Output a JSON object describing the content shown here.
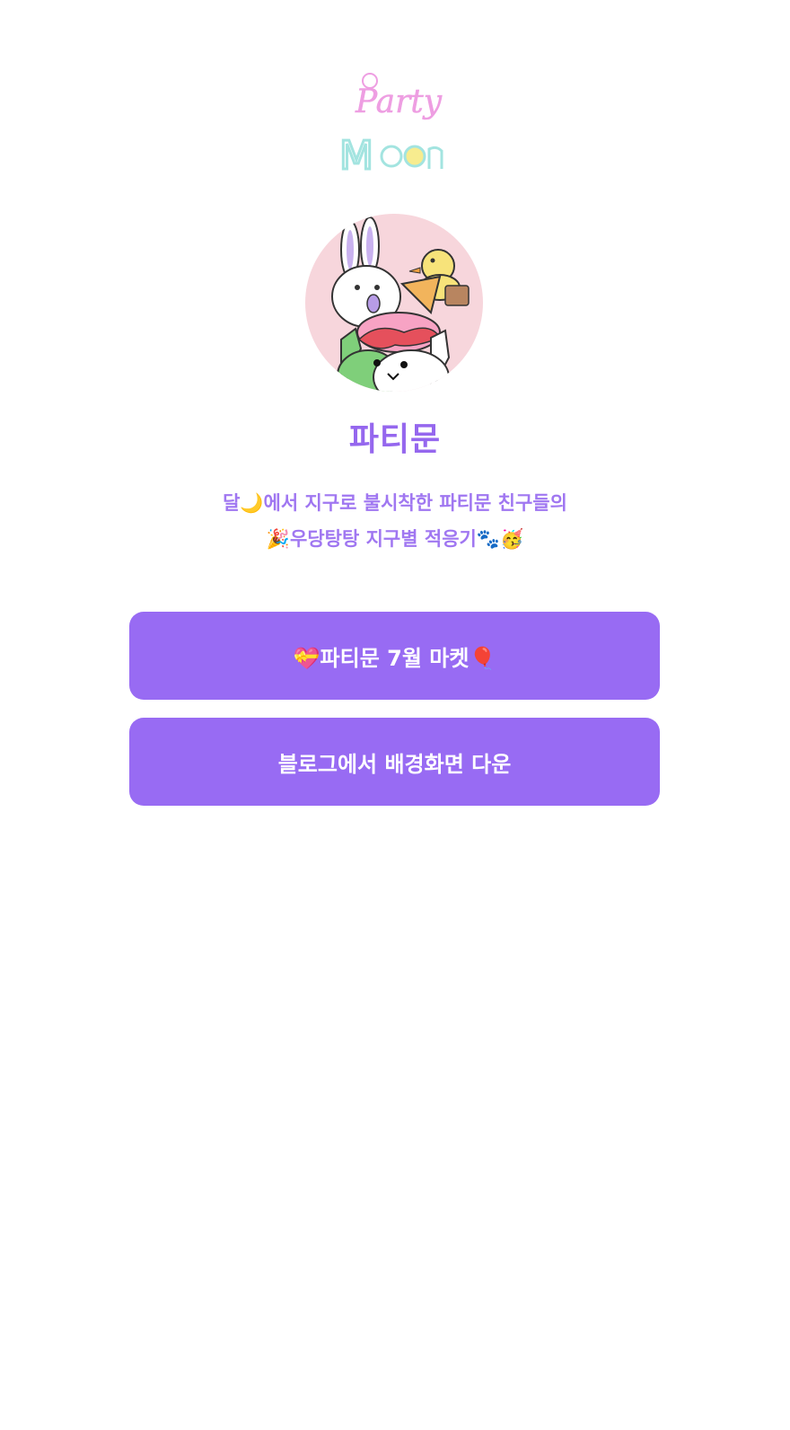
{
  "profile": {
    "logo_text_top": "Party",
    "logo_text_bottom": "Moon",
    "name": "파티문",
    "bio_line1": "달🌙에서 지구로 불시착한 파티문 친구들의",
    "bio_line2": "🎉우당탕탕 지구별 적응기🐾🥳"
  },
  "links": [
    {
      "label": "💝파티문 7월 마켓🎈"
    },
    {
      "label": "블로그에서 배경화면 다운"
    }
  ],
  "colors": {
    "accent": "#986bf3",
    "title": "#9567ee",
    "avatar_bg": "#f7d6dc"
  }
}
